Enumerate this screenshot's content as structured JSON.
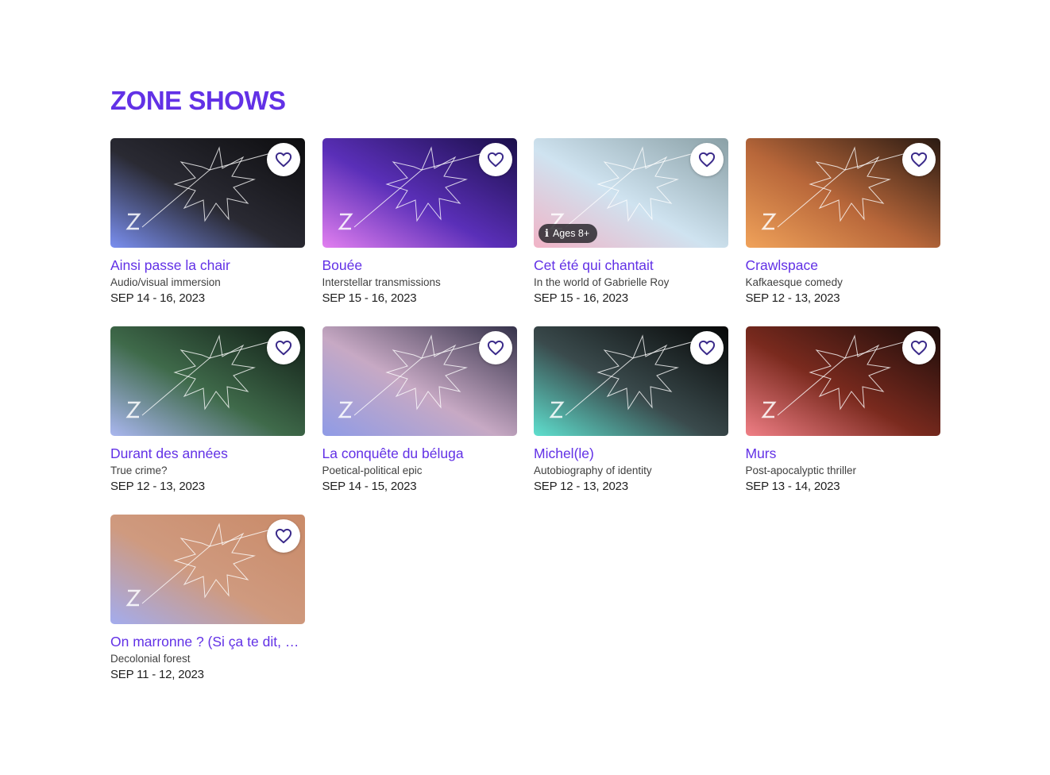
{
  "section": {
    "title": "ZONE SHOWS"
  },
  "colors": {
    "accent": "#6231e6",
    "heart": "#3a2a8a"
  },
  "shows": [
    {
      "title": "Ainsi passe la chair",
      "tagline": "Audio/visual immersion",
      "dates": "SEP 14 - 16, 2023",
      "badge": "",
      "image_colors": [
        "#7a8ff0",
        "#2a2a33",
        "#0d0d0f"
      ]
    },
    {
      "title": "Bouée",
      "tagline": "Interstellar transmissions",
      "dates": "SEP 15 - 16, 2023",
      "badge": "",
      "image_colors": [
        "#e27ff0",
        "#5a2fb8",
        "#1b0f4a"
      ]
    },
    {
      "title": "Cet été qui chantait",
      "tagline": "In the world of Gabrielle Roy",
      "dates": "SEP 15 - 16, 2023",
      "badge": "Ages 8+",
      "image_colors": [
        "#f1b3c6",
        "#cfe3f0",
        "#8aa0a6"
      ]
    },
    {
      "title": "Crawlspace",
      "tagline": "Kafkaesque comedy",
      "dates": "SEP 12 - 13, 2023",
      "badge": "",
      "image_colors": [
        "#f0a25a",
        "#b8673a",
        "#2a1a12"
      ]
    },
    {
      "title": "Durant des années",
      "tagline": "True crime?",
      "dates": "SEP 12 - 13, 2023",
      "badge": "",
      "image_colors": [
        "#aab7f0",
        "#3f6a4a",
        "#0f1a14"
      ]
    },
    {
      "title": "La conquête du béluga",
      "tagline": "Poetical-political epic",
      "dates": "SEP 14 - 15, 2023",
      "badge": "",
      "image_colors": [
        "#8f9be6",
        "#c7a9c4",
        "#35324a"
      ]
    },
    {
      "title": "Michel(le)",
      "tagline": "Autobiography of identity",
      "dates": "SEP 12 - 13, 2023",
      "badge": "",
      "image_colors": [
        "#5fe0cf",
        "#3a4a4c",
        "#060707"
      ]
    },
    {
      "title": "Murs",
      "tagline": "Post-apocalyptic thriller",
      "dates": "SEP 13 - 14, 2023",
      "badge": "",
      "image_colors": [
        "#f07f86",
        "#7a2a1e",
        "#1a0c0a"
      ]
    },
    {
      "title": "On marronne ? (Si ça te dit, viens)",
      "tagline": "Decolonial forest",
      "dates": "SEP 11 - 12, 2023",
      "badge": "",
      "image_colors": [
        "#a3acee",
        "#cf9a7f",
        "#c98a68"
      ]
    }
  ]
}
